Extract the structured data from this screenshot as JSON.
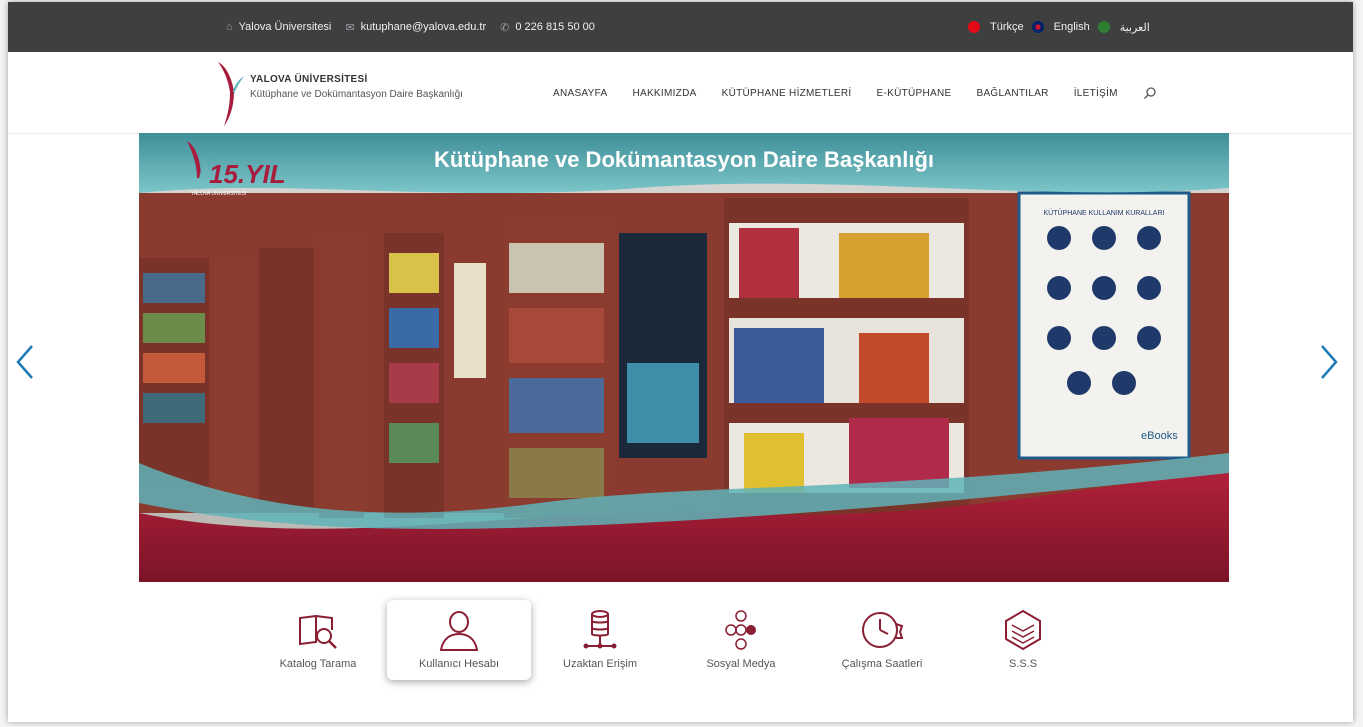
{
  "topbar": {
    "university": "Yalova Üniversitesi",
    "email": "kutuphane@yalova.edu.tr",
    "phone": "0 226 815 50 00",
    "languages": [
      "Türkçe",
      "English",
      "العربية"
    ]
  },
  "brand": {
    "university": "YALOVA ÜNİVERSİTESİ",
    "department": "Kütüphane ve Dokümantasyon Daire Başkanlığı"
  },
  "nav": {
    "items": [
      "ANASAYFA",
      "HAKKIMIZDA",
      "KÜTÜPHANE HİZMETLERİ",
      "E-KÜTÜPHANE",
      "BAĞLANTILAR",
      "İLETİŞİM"
    ]
  },
  "slider": {
    "title": "Kütüphane ve Dokümantasyon Daire Başkanlığı",
    "anniversary": "15.YIL",
    "anniversary_sub": "YALOVA ÜNİVERSİTESİ",
    "poster_title": "KÜTÜPHANE KULLANIM KURALLARI",
    "poster_footer": "eBooks"
  },
  "quick_links": [
    {
      "label": "Katalog Tarama",
      "icon": "book-search-icon"
    },
    {
      "label": "Kullanıcı Hesabı",
      "icon": "user-icon"
    },
    {
      "label": "Uzaktan Erişim",
      "icon": "database-icon"
    },
    {
      "label": "Sosyal Medya",
      "icon": "social-media-icon"
    },
    {
      "label": "Çalışma Saatleri",
      "icon": "clock-icon"
    },
    {
      "label": "S.S.S",
      "icon": "faq-icon"
    }
  ],
  "colors": {
    "topbar": "#3f3f3f",
    "accent_red": "#a81c3d",
    "teal": "#5fb3b8",
    "arrow_blue": "#1f7ab8"
  }
}
